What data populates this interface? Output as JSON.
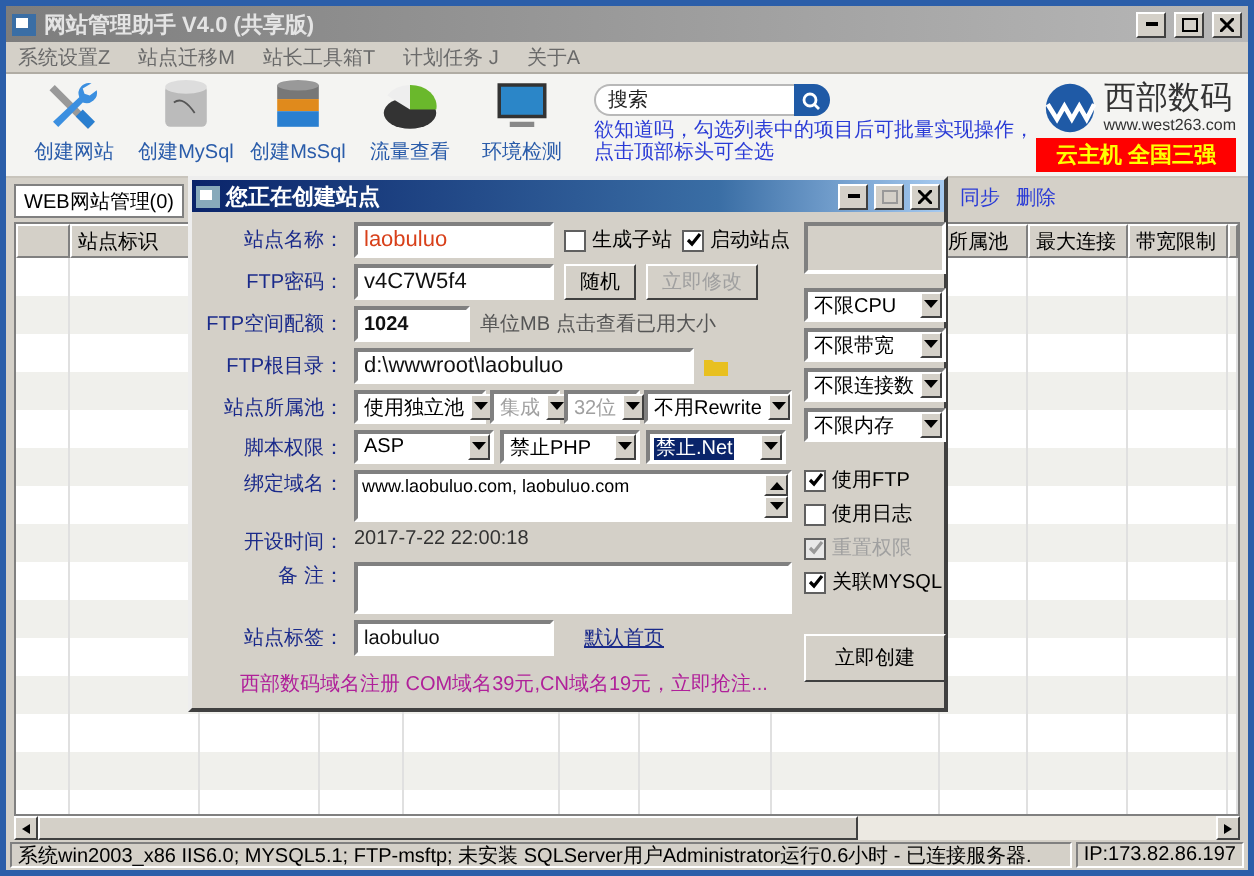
{
  "window": {
    "title": "网站管理助手 V4.0 (共享版)"
  },
  "menu": [
    "系统设置Z",
    "站点迁移M",
    "站长工具箱T",
    "计划任务 J",
    "关于A"
  ],
  "toolbar": [
    {
      "label": "创建网站",
      "kind": "tools"
    },
    {
      "label": "创建MySql",
      "kind": "mysql"
    },
    {
      "label": "创建MsSql",
      "kind": "mssql"
    },
    {
      "label": "流量查看",
      "kind": "traffic"
    },
    {
      "label": "环境检测",
      "kind": "monitor"
    }
  ],
  "search": {
    "placeholder": "搜索"
  },
  "hint": "欲知道吗，勾选列表中的项目后可批量实现操作，点击顶部标头可全选",
  "logo": {
    "name": "西部数码",
    "url": "www.west263.com",
    "banner": "云主机 全国三强"
  },
  "tabs": [
    {
      "label": "WEB网站管理(0)",
      "selected": true
    }
  ],
  "actions": [
    "同步",
    "删除"
  ],
  "table": {
    "columns": [
      "站点标识",
      "所属池",
      "最大连接",
      "带宽限制"
    ]
  },
  "status_bar": {
    "info": "系统win2003_x86 IIS6.0; MYSQL5.1; FTP-msftp; 未安装 SQLServer用户Administrator运行0.6小时 - 已连接服务器.",
    "ip": "IP:173.82.86.197"
  },
  "dialog": {
    "title": "您正在创建站点",
    "site_name": {
      "label": "站点名称：",
      "value": "laobuluo"
    },
    "options": [
      {
        "label": "生成子站",
        "checked": false
      },
      {
        "label": "启动站点",
        "checked": true
      }
    ],
    "ftp_password": {
      "label": "FTP密码：",
      "value": "v4C7W5f4",
      "buttons": [
        {
          "label": "随机",
          "disabled": false
        },
        {
          "label": "立即修改",
          "disabled": true
        }
      ]
    },
    "ftp_quota": {
      "label": "FTP空间配额：",
      "value": "1024",
      "note": "单位MB 点击查看已用大小"
    },
    "ftp_root": {
      "label": "FTP根目录：",
      "value": "d:\\wwwroot\\laobuluo"
    },
    "pool": {
      "label": "站点所属池：",
      "selects": [
        {
          "value": "使用独立池",
          "disabled": false
        },
        {
          "value": "集成",
          "disabled": true
        },
        {
          "value": "32位",
          "disabled": true
        },
        {
          "value": "不用Rewrite",
          "disabled": false
        }
      ]
    },
    "script": {
      "label": "脚本权限：",
      "selects": [
        {
          "value": "ASP",
          "focused": false
        },
        {
          "value": "禁止PHP",
          "focused": false
        },
        {
          "value": "禁止.Net",
          "focused": true
        }
      ]
    },
    "domains": {
      "label": "绑定域名：",
      "value": "www.laobuluo.com, laobuluo.com"
    },
    "created": {
      "label": "开设时间：",
      "value": "2017-7-22 22:00:18"
    },
    "remark": {
      "label": "备 注："
    },
    "tag": {
      "label": "站点标签：",
      "value": "laobuluo",
      "link": "默认首页"
    },
    "promo": "西部数码域名注册 COM域名39元,CN域名19元，立即抢注...",
    "limits": [
      "不限CPU",
      "不限带宽",
      "不限连接数",
      "不限内存"
    ],
    "flags": [
      {
        "label": "使用FTP",
        "checked": true,
        "disabled": false
      },
      {
        "label": "使用日志",
        "checked": false,
        "disabled": false
      },
      {
        "label": "重置权限",
        "checked": true,
        "disabled": true
      },
      {
        "label": "关联MYSQL",
        "checked": true,
        "disabled": false
      }
    ],
    "submit": "立即创建"
  }
}
